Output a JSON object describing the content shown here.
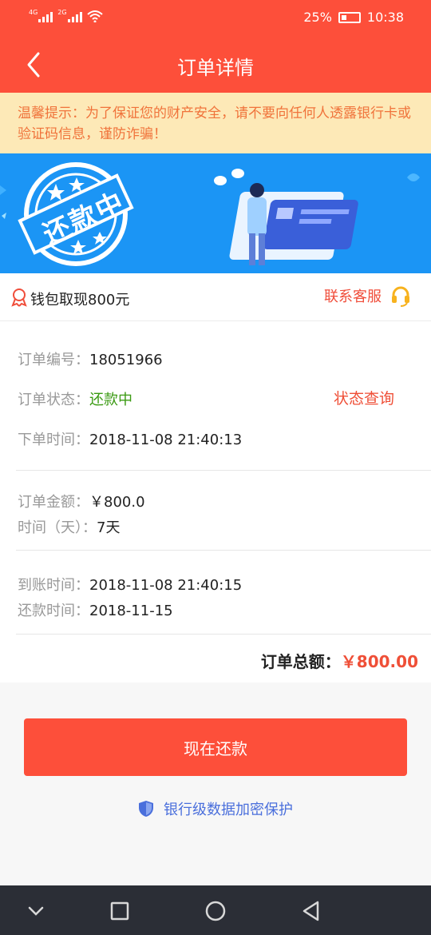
{
  "status_bar": {
    "network1": "4G",
    "network2": "2G",
    "battery": "25%",
    "time": "10:38"
  },
  "header": {
    "title": "订单详情"
  },
  "notice": {
    "text": "温馨提示：为了保证您的财产安全，请不要向任何人透露银行卡或验证码信息，谨防诈骗！"
  },
  "banner": {
    "stamp_text": "还款中"
  },
  "product": {
    "name": "钱包取现800元",
    "contact_label": "联系客服"
  },
  "order": {
    "number_label": "订单编号：",
    "number": "18051966",
    "status_label": "订单状态：",
    "status": "还款中",
    "status_query": "状态查询",
    "created_label": "下单时间：",
    "created": "2018-11-08 21:40:13",
    "amount_label": "订单金额：",
    "amount": "￥800.0",
    "duration_label": "时间（天）：",
    "duration": "7天",
    "arrival_label": "到账时间：",
    "arrival": "2018-11-08 21:40:15",
    "repay_label": "还款时间：",
    "repay": "2018-11-15",
    "total_label": "订单总额：",
    "total": "￥800.00"
  },
  "actions": {
    "pay_label": "现在还款",
    "secure_text": "银行级数据加密保护"
  },
  "colors": {
    "accent": "#fd4f3a",
    "notice_bg": "#fde9b7",
    "status_green": "#3a9a12",
    "secure_blue": "#4a6fdc",
    "banner_blue": "#1b95f5"
  }
}
